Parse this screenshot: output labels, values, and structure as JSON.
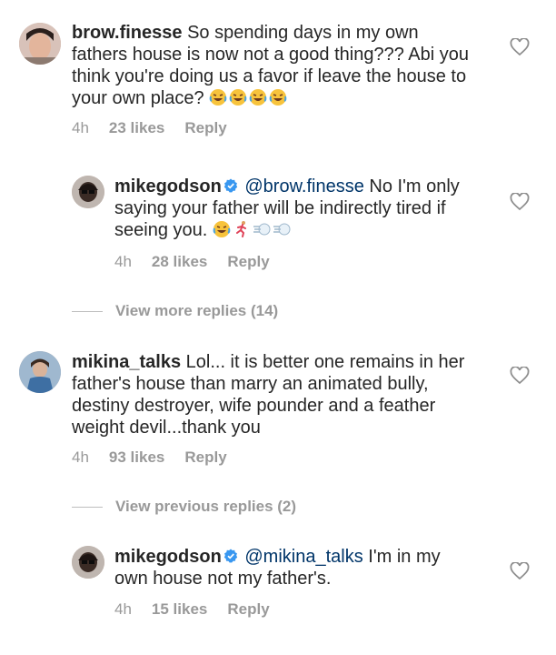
{
  "comments": [
    {
      "username": "brow.finesse",
      "text": "So spending days in my own fathers house is now not a good thing??? Abi you think you're doing us a favor if leave the house to your own place?",
      "emoji_count": 4,
      "time": "4h",
      "likes": "23 likes",
      "reply_label": "Reply"
    },
    {
      "username": "mikegodson",
      "mention": "@brow.finesse",
      "text": "No I'm only saying your father will be indirectly tired if seeing you.",
      "time": "4h",
      "likes": "28 likes",
      "reply_label": "Reply"
    },
    {
      "username": "mikina_talks",
      "text": "Lol... it is better one remains in her father's house than marry an animated bully, destiny destroyer, wife pounder and a feather weight devil...thank you",
      "time": "4h",
      "likes": "93 likes",
      "reply_label": "Reply"
    },
    {
      "username": "mikegodson",
      "mention": "@mikina_talks",
      "text": "I'm in my own house not my father's.",
      "time": "4h",
      "likes": "15 likes",
      "reply_label": "Reply"
    }
  ],
  "view_more_replies": "View more replies (14)",
  "view_previous_replies": "View previous replies (2)",
  "colors": {
    "text": "#262626",
    "meta": "#999999",
    "verified": "#3897f0",
    "mention": "#003569"
  }
}
